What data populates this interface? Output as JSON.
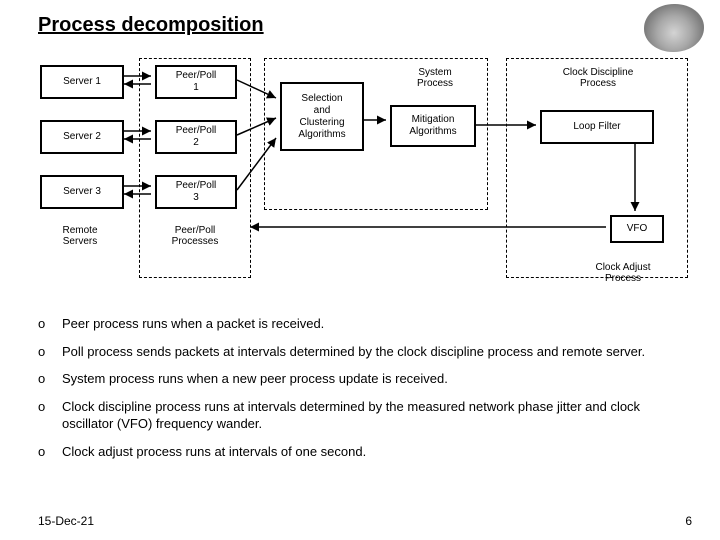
{
  "title": "Process decomposition",
  "servers": [
    "Server 1",
    "Server 2",
    "Server 3"
  ],
  "remote_label": "Remote\nServers",
  "peerpoll": [
    "Peer/Poll\n1",
    "Peer/Poll\n2",
    "Peer/Poll\n3"
  ],
  "peerpoll_label": "Peer/Poll\nProcesses",
  "selection": "Selection\nand\nClustering\nAlgorithms",
  "system_process": "System\nProcess",
  "mitigation": "Mitigation\nAlgorithms",
  "clock_discipline": "Clock Discipline\nProcess",
  "loop_filter": "Loop Filter",
  "vfo": "VFO",
  "clock_adjust": "Clock Adjust\nProcess",
  "bullets": [
    "Peer process runs when a packet is received.",
    "Poll process sends packets at intervals determined by the clock discipline process and remote server.",
    "System process runs when a new peer process update is received.",
    "Clock discipline process runs at intervals determined by the measured network phase jitter and clock oscillator (VFO) frequency wander.",
    "Clock adjust process runs at intervals of one second."
  ],
  "footer_date": "15-Dec-21",
  "page_no": "6"
}
